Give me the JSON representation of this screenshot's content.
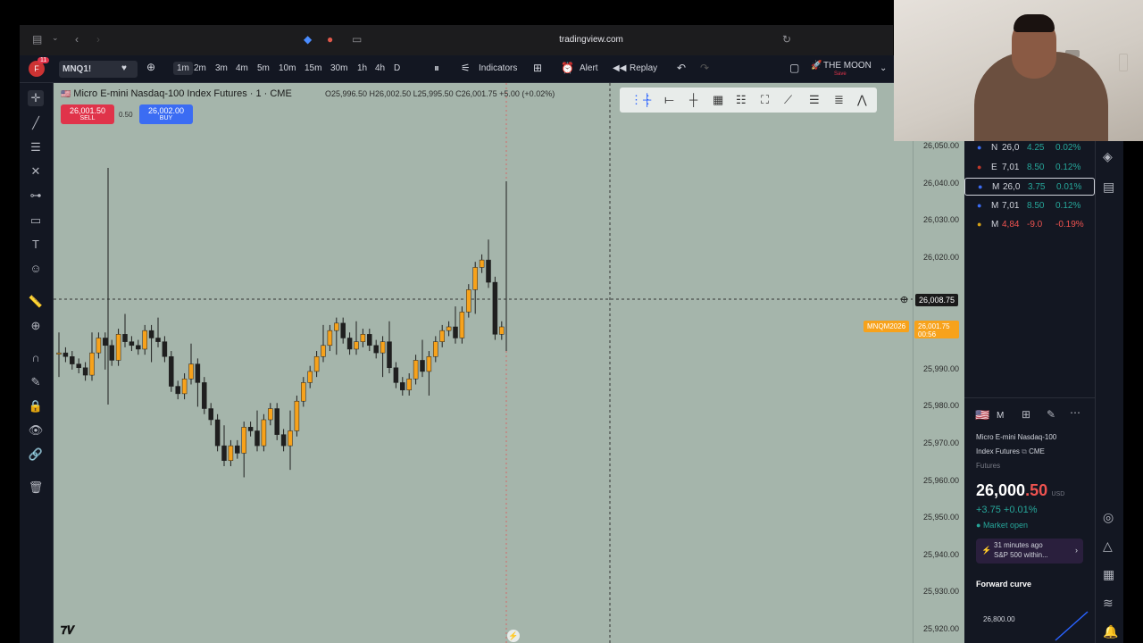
{
  "browser": {
    "url": "tradingview.com"
  },
  "toolbar": {
    "notification_count": "11",
    "symbol": "MNQ1!",
    "timeframes": [
      "1m",
      "2m",
      "3m",
      "4m",
      "5m",
      "10m",
      "15m",
      "30m",
      "1h",
      "4h",
      "D"
    ],
    "indicators_label": "Indicators",
    "alert_label": "Alert",
    "replay_label": "Replay",
    "layout_name": "THE MOON",
    "layout_sub": "Save"
  },
  "legend": {
    "title": "Micro E-mini Nasdaq-100 Index Futures · 1 · CME",
    "ohlc": "O25,996.50 H26,002.50 L25,995.50 C26,001.75 +5.00 (+0.02%)"
  },
  "trade": {
    "sell_price": "26,001.50",
    "sell_label": "SELL",
    "spread": "0.50",
    "buy_price": "26,002.00",
    "buy_label": "BUY"
  },
  "price_axis": {
    "ticks": [
      "26,050.00",
      "26,040.00",
      "26,030.00",
      "26,020.00",
      "25,990.00",
      "25,980.00",
      "25,970.00",
      "25,960.00",
      "25,950.00",
      "25,940.00",
      "25,930.00",
      "25,920.00"
    ],
    "crosshair_price": "26,008.75",
    "current_symbol": "MNQM2026",
    "current_price": "26,001.75",
    "countdown": "00:56"
  },
  "watchlist": [
    {
      "sym": "N",
      "price": "26,0",
      "chg": "4.25",
      "pct": "0.02%",
      "dir": "up",
      "icon": "nq-icon"
    },
    {
      "sym": "E",
      "price": "7,01",
      "chg": "8.50",
      "pct": "0.12%",
      "dir": "up",
      "icon": "es-500-icon"
    },
    {
      "sym": "M",
      "price": "26,0",
      "chg": "3.75",
      "pct": "0.01%",
      "dir": "up",
      "icon": "us-flag-icon"
    },
    {
      "sym": "M",
      "price": "7,01",
      "chg": "8.50",
      "pct": "0.12%",
      "dir": "up",
      "icon": "us-flag-icon"
    },
    {
      "sym": "M",
      "price": "4,84",
      "chg": "-9.0",
      "pct": "-0.19%",
      "dir": "down",
      "icon": "gold-icon"
    }
  ],
  "details": {
    "sym": "M",
    "name_line1": "Micro E-mini Nasdaq-100",
    "name_line2": "Index Futures",
    "exchange": "CME",
    "type": "Futures",
    "price_main": "26,000",
    "price_frac": ".50",
    "currency": "USD",
    "change": "+3.75",
    "change_pct": "+0.01%",
    "status": "Market open",
    "news_time": "31 minutes ago",
    "news_text": "S&P 500 within...",
    "forward_curve_label": "Forward curve",
    "forward_curve_value": "26,800.00"
  },
  "colors": {
    "up": "#26a69a",
    "down": "#ef5350",
    "chart_bg": "#a5b5ab",
    "candle_up": "#f7a21b",
    "candle_down": "#1f1f1f",
    "accent": "#2962ff"
  }
}
